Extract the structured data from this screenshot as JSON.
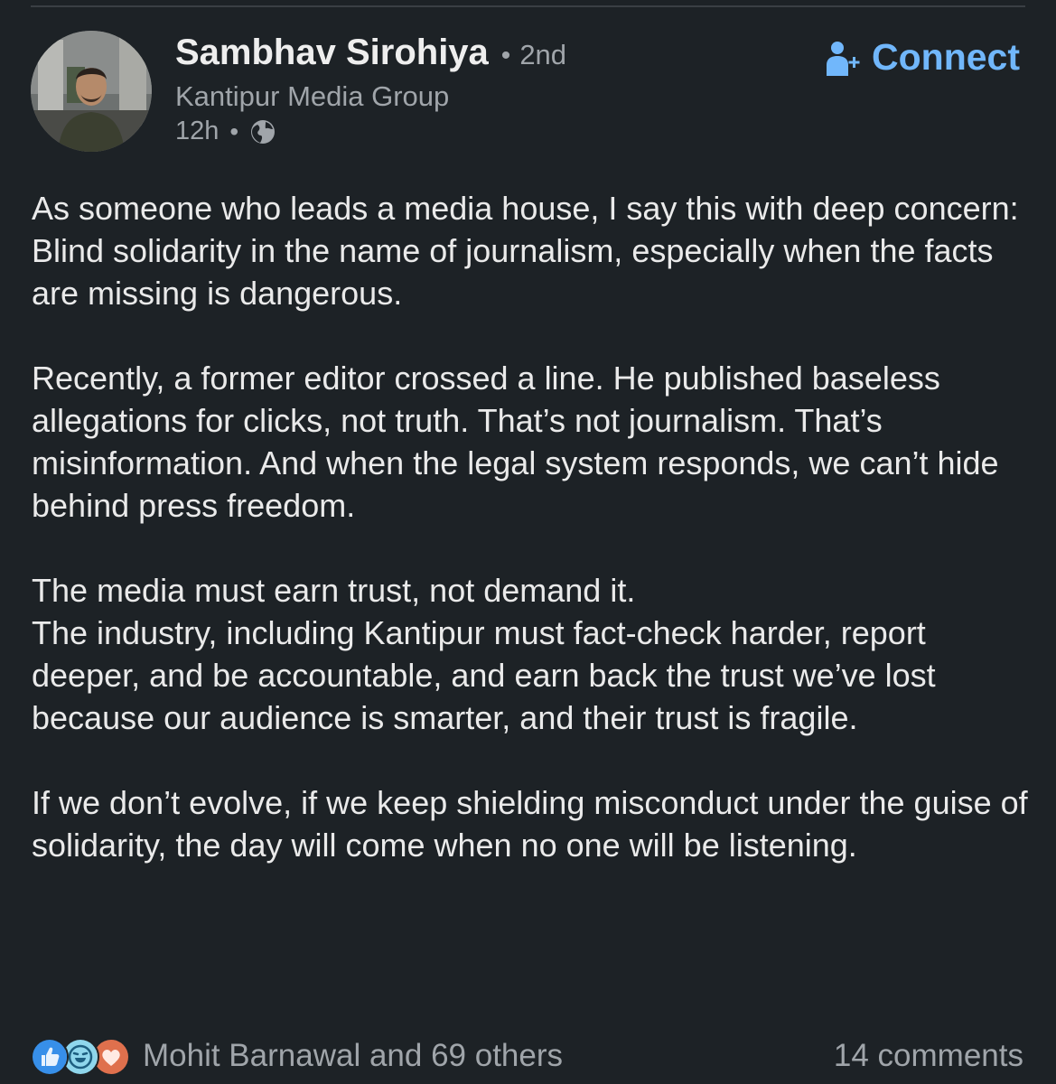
{
  "post": {
    "author": {
      "name": "Sambhav Sirohiya",
      "separator": "•",
      "degree": "2nd",
      "headline": "Kantipur Media Group",
      "time": "12h",
      "time_separator": "•",
      "visibility_icon": "globe-icon",
      "avatar_icon": "profile-photo"
    },
    "connect": {
      "label": "Connect",
      "icon": "add-person-icon",
      "color": "#71b7fb"
    },
    "body": {
      "paragraphs": [
        "As someone who leads a media house, I say this with deep concern:\nBlind solidarity in the name of journalism, especially when the facts are missing is dangerous.",
        "Recently, a former editor crossed a line. He published baseless allegations for clicks, not truth. That’s not journalism. That’s misinformation. And when the legal system responds, we can’t hide behind press freedom.",
        "The media must earn trust, not demand it.\nThe industry, including Kantipur must fact-check harder, report deeper, and be accountable, and earn back the trust we’ve lost because our audience is smarter, and their trust is fragile.",
        "If we don’t evolve, if we keep shielding misconduct under the guise of solidarity, the day will come when no one will be listening."
      ]
    },
    "social": {
      "reaction_icons": [
        "like-icon",
        "funny-icon",
        "love-icon"
      ],
      "reactions_text": "Mohit Barnawal and 69 others",
      "comments_text": "14 comments"
    }
  },
  "theme": {
    "background": "#1d2226",
    "text": "#eaeaea",
    "muted": "#a0a5aa",
    "accent": "#71b7fb"
  }
}
